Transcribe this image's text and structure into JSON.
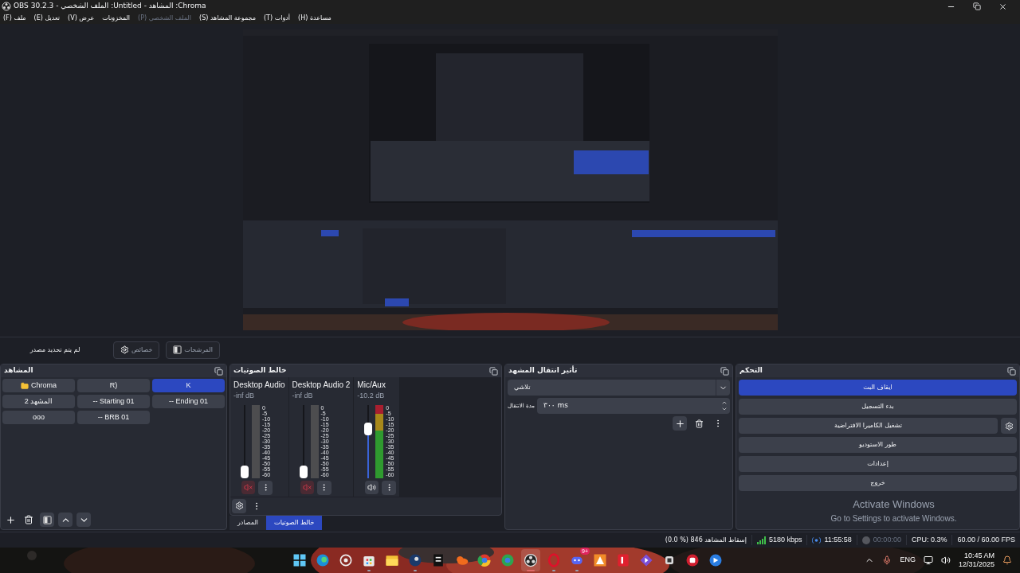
{
  "window": {
    "title": "OBS 30.2.3 - الملف الشخصي :Untitled - المشاهد :Chroma"
  },
  "menu": [
    {
      "label": "(H) مساعدة",
      "disabled": false
    },
    {
      "label": "(T) أدوات",
      "disabled": false
    },
    {
      "label": "(S) مجموعة المشاهد",
      "disabled": false
    },
    {
      "label": "(P) الملف الشخصي",
      "disabled": true
    },
    {
      "label": "المخزونات",
      "disabled": false
    },
    {
      "label": "(V) عرض",
      "disabled": false
    },
    {
      "label": "(E) تعديل",
      "disabled": false
    },
    {
      "label": "(F) ملف",
      "disabled": false
    }
  ],
  "source_toolbar": {
    "status": "لم يتم تحديد مصدر",
    "buttons": [
      {
        "label": "المرشحات",
        "kind": "filters",
        "disabled": true
      },
      {
        "label": "خصائص",
        "kind": "properties",
        "disabled": true
      }
    ]
  },
  "scenes": {
    "title": "المشاهد",
    "items": [
      {
        "label": "K",
        "kind": "scene",
        "selected": true
      },
      {
        "label": "R)",
        "kind": "scene",
        "selected": false
      },
      {
        "label": "Chroma",
        "kind": "group",
        "selected": false
      },
      {
        "label": "-- Ending 01",
        "kind": "scene",
        "selected": false
      },
      {
        "label": "-- Starting 01",
        "kind": "scene",
        "selected": false
      },
      {
        "label": "المشهد 2",
        "kind": "scene",
        "selected": false
      },
      {
        "label": "-- BRB 01",
        "kind": "scene",
        "selected": false
      },
      {
        "label": "ooo",
        "kind": "scene",
        "selected": false
      }
    ]
  },
  "mixer": {
    "title": "خالط الصوتيات",
    "channels": [
      {
        "name": "Mic/Aux",
        "reading": "-10.2 dB",
        "muted": false,
        "volume": {
          "level": 0.7
        },
        "meter": {
          "level": 1
        },
        "scale": [
          "0",
          "-5",
          "-10",
          "-15",
          "-20",
          "-25",
          "-30",
          "-35",
          "-40",
          "-45",
          "-50",
          "-55",
          "-60"
        ]
      },
      {
        "name": "Desktop Audio 2",
        "reading": "-inf dB",
        "muted": true,
        "volume": {
          "level": 0
        },
        "meter": {
          "level": 0
        },
        "scale": [
          "0",
          "-5",
          "-10",
          "-15",
          "-20",
          "-25",
          "-30",
          "-35",
          "-40",
          "-45",
          "-50",
          "-55",
          "-60"
        ]
      },
      {
        "name": "Desktop Audio",
        "reading": "-inf dB",
        "muted": true,
        "volume": {
          "level": 0
        },
        "meter": {
          "level": 0
        },
        "scale": [
          "0",
          "-5",
          "-10",
          "-15",
          "-20",
          "-25",
          "-30",
          "-35",
          "-40",
          "-45",
          "-50",
          "-55",
          "-60"
        ]
      }
    ]
  },
  "dock_tabs": [
    {
      "label": "خالط الصوتيات",
      "selected": true
    },
    {
      "label": "المصادر",
      "selected": false
    }
  ],
  "transitions": {
    "title": "تأثير انتقال المشهد",
    "effect": "تلاشي",
    "duration_label": "مدة الانتقال",
    "duration": "٣٠٠ ms"
  },
  "controls": {
    "title": "التحكم",
    "buttons": [
      {
        "label": "ايقاف البث",
        "active": true,
        "kind": "plain"
      },
      {
        "label": "بدء التسجيل",
        "active": false,
        "kind": "plain"
      },
      {
        "label": "تشغيل الكاميرا الافتراضية",
        "active": false,
        "kind": "with-settings"
      },
      {
        "label": "طور الاستوديو",
        "active": false,
        "kind": "plain"
      },
      {
        "label": "إعدادات",
        "active": false,
        "kind": "plain"
      },
      {
        "label": "خروج",
        "active": false,
        "kind": "plain"
      }
    ]
  },
  "activation": {
    "title": "Activate Windows",
    "subtitle": "Go to Settings to activate Windows."
  },
  "status_bar": {
    "dropped": "(0.0 %) 846 إسقاط المشاهد",
    "bitrate": "5180 kbps",
    "stream_time": "11:55:58",
    "recording": false,
    "record_time": "00:00:00",
    "cpu": "CPU: 0.3%",
    "fps": "60.00 / 60.00 FPS"
  },
  "taskbar": {
    "apps": [
      {
        "running": false,
        "selected": false
      },
      {
        "running": false,
        "selected": false
      },
      {
        "running": false,
        "selected": false
      },
      {
        "running": true,
        "selected": false
      },
      {
        "running": false,
        "selected": false
      },
      {
        "running": true,
        "selected": false
      },
      {
        "running": false,
        "selected": false
      },
      {
        "running": false,
        "selected": false
      },
      {
        "running": false,
        "selected": false
      },
      {
        "running": false,
        "selected": false
      },
      {
        "running": true,
        "selected": true
      },
      {
        "running": true,
        "selected": false
      },
      {
        "running": true,
        "selected": false,
        "badge": "9+"
      },
      {
        "running": false,
        "selected": false
      },
      {
        "running": false,
        "selected": false
      },
      {
        "running": false,
        "selected": false
      },
      {
        "running": false,
        "selected": false
      },
      {
        "running": false,
        "selected": false
      },
      {
        "running": false,
        "selected": false
      }
    ],
    "language": "ENG",
    "time": "10:45 AM",
    "date": "12/31/2025"
  }
}
